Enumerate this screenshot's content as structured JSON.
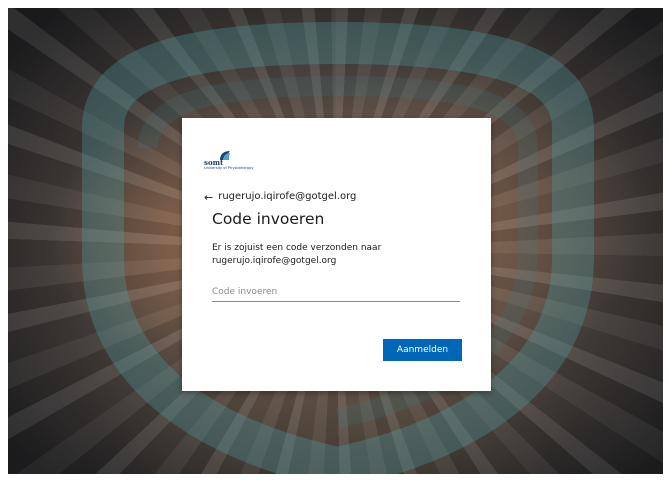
{
  "org": {
    "logo_name": "somt",
    "logo_subtitle": "University of Physiotherapy",
    "logo_color": "#1d3f7a"
  },
  "signin": {
    "back_arrow_icon": "arrow-left-icon",
    "back_arrow_glyph": "←",
    "account_email": "rugerujo.iqirofe@gotgel.org",
    "title": "Code invoeren",
    "description": "Er is zojuist een code verzonden naar rugerujo.iqirofe@gotgel.org",
    "code_input": {
      "value": "",
      "placeholder": "Code invoeren"
    },
    "submit_label": "Aanmelden",
    "accent_color": "#0067b8"
  }
}
